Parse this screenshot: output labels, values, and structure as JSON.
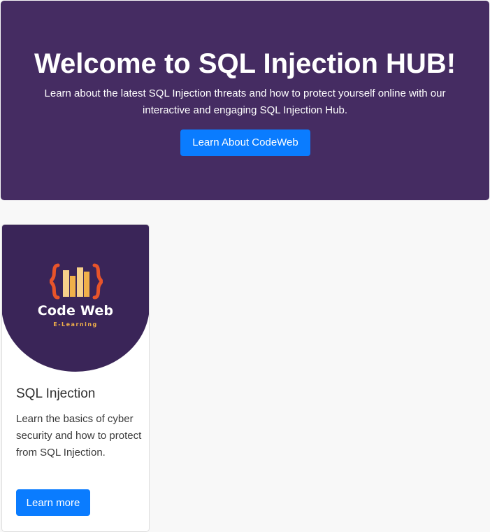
{
  "hero": {
    "title": "Welcome to SQL Injection HUB!",
    "description": "Learn about the latest SQL Injection threats and how to protect yourself online with our interactive and engaging SQL Injection Hub.",
    "button_label": "Learn About CodeWeb"
  },
  "card": {
    "logo": {
      "name": "Code Web",
      "tagline": "E-Learning",
      "icon": "code-books-logo-icon"
    },
    "title": "SQL Injection",
    "text": "Learn the basics of cyber security and how to protect from SQL Injection.",
    "button_label": "Learn more"
  },
  "colors": {
    "hero_background": "#452c62",
    "card_media_background": "#3a2558",
    "primary_button": "#0a7cff",
    "logo_brace": "#e8542a",
    "logo_book_light": "#f6d08a",
    "logo_book_mid": "#f0b04a",
    "logo_tagline": "#f0b04a",
    "page_background": "#f8f8f8"
  }
}
